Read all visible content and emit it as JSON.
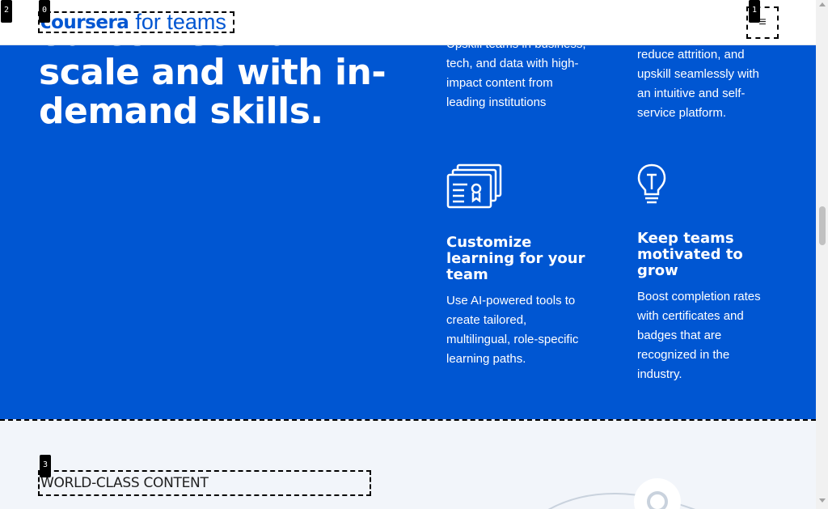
{
  "brand": {
    "logo_main": "coursera",
    "logo_sub": "for teams",
    "brand_color": "#0056D2"
  },
  "nav": {
    "menu_icon": "≡"
  },
  "hero": {
    "title": "outcomes - at scale and with in-demand skills.",
    "background_color": "#0056D2"
  },
  "features": [
    {
      "heading": "",
      "body": "Upskill teams in business, tech, and data with high-impact content from leading institutions"
    },
    {
      "heading": "",
      "body": "reduce attrition, and upskill seamlessly with an intuitive and self-service platform."
    },
    {
      "icon": "certificates-icon",
      "heading": "Customize learning for your team",
      "body": "Use AI-powered tools to create tailored, multilingual, role-specific learning paths."
    },
    {
      "icon": "lightbulb-icon",
      "heading": "Keep teams motivated to grow",
      "body": "Boost completion rates with certificates and badges that are recognized in the industry."
    }
  ],
  "content_section": {
    "label": "WORLD-CLASS CONTENT"
  },
  "badges": [
    "0",
    "1",
    "2",
    "3"
  ]
}
